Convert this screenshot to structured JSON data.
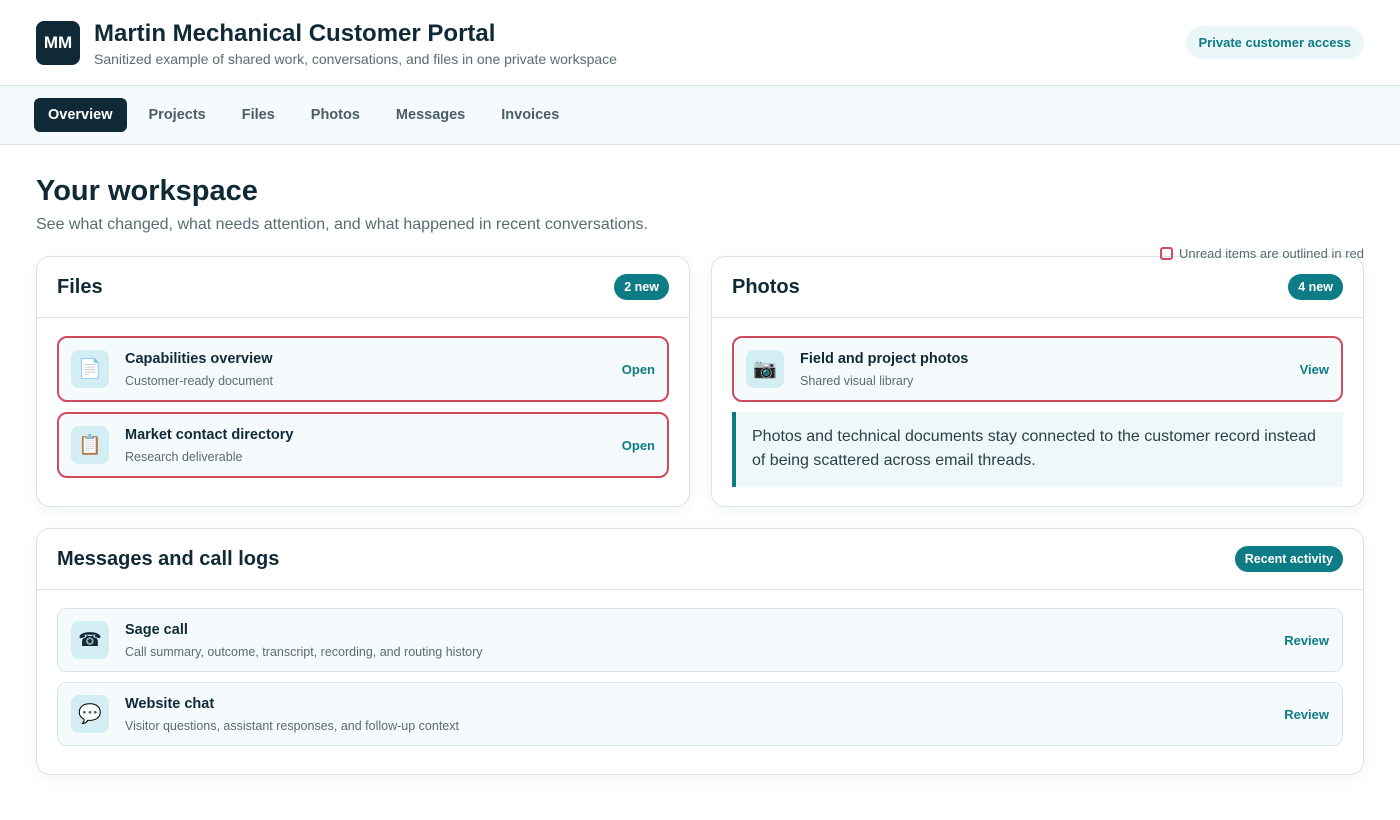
{
  "header": {
    "logo_initials": "MM",
    "title": "Martin Mechanical Customer Portal",
    "subtitle": "Sanitized example of shared work, conversations, and files in one private workspace",
    "access_label": "Private customer access"
  },
  "nav": {
    "tabs": [
      {
        "label": "Overview",
        "active": true
      },
      {
        "label": "Projects",
        "active": false
      },
      {
        "label": "Files",
        "active": false
      },
      {
        "label": "Photos",
        "active": false
      },
      {
        "label": "Messages",
        "active": false
      },
      {
        "label": "Invoices",
        "active": false
      }
    ]
  },
  "workspace": {
    "title": "Your workspace",
    "subtitle": "See what changed, what needs attention, and what happened in recent conversations.",
    "legend": "Unread items are outlined in red"
  },
  "files": {
    "title": "Files",
    "badge": "2 new",
    "items": [
      {
        "icon": "document-icon",
        "title": "Capabilities overview",
        "subtitle": "Customer-ready document",
        "action": "Open",
        "unread": true
      },
      {
        "icon": "clipboard-icon",
        "title": "Market contact directory",
        "subtitle": "Research deliverable",
        "action": "Open",
        "unread": true
      }
    ]
  },
  "photos": {
    "title": "Photos",
    "badge": "4 new",
    "items": [
      {
        "icon": "camera-icon",
        "title": "Field and project photos",
        "subtitle": "Shared visual library",
        "action": "View",
        "unread": true
      }
    ],
    "note": "Photos and technical documents stay connected to the customer record instead of being scattered across email threads."
  },
  "messages": {
    "title": "Messages and call logs",
    "badge": "Recent activity",
    "items": [
      {
        "icon": "phone-icon",
        "title": "Sage call",
        "subtitle": "Call summary, outcome, transcript, recording, and routing history",
        "action": "Review",
        "unread": false
      },
      {
        "icon": "chat-bubble-icon",
        "title": "Website chat",
        "subtitle": "Visitor questions, assistant responses, and follow-up context",
        "action": "Review",
        "unread": false
      }
    ]
  },
  "colors": {
    "primary_dark": "#0f2a36",
    "accent_teal": "#0e7c86",
    "unread_red": "#d04a5e"
  }
}
